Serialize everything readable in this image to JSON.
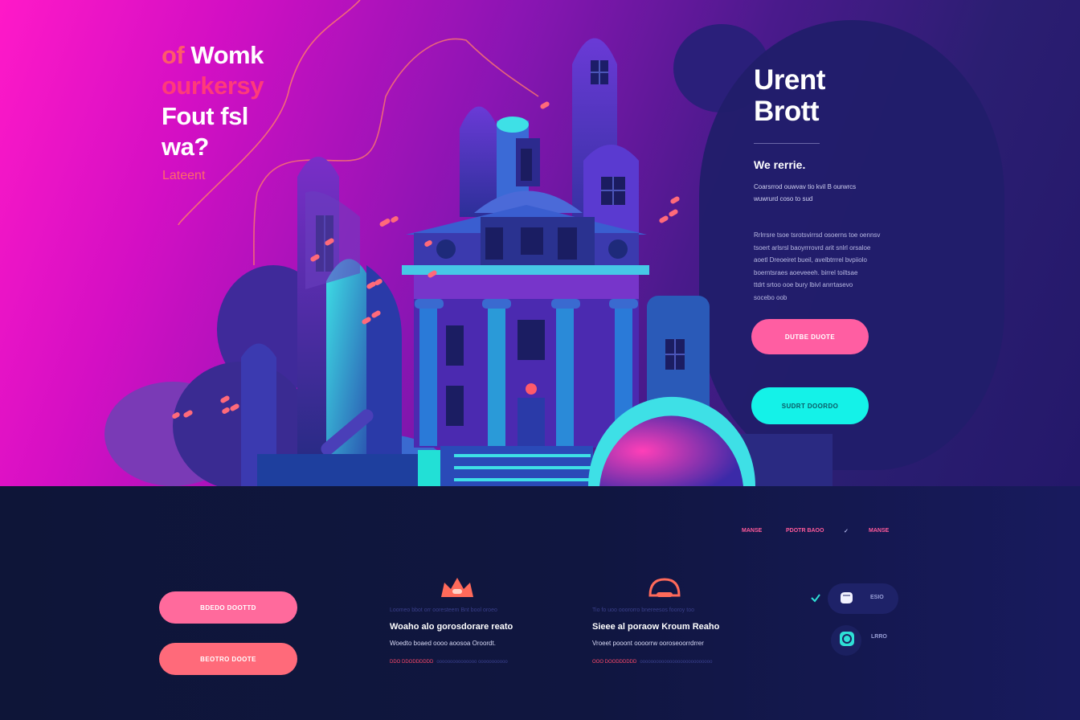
{
  "hero": {
    "headline": {
      "line1_accent": "of",
      "line1_text": "Womk",
      "line2": "ourkersy",
      "line3": "Fout fsl",
      "line4": "wa?"
    },
    "subline": "Lateent",
    "colors": {
      "pink": "#ff19c8",
      "coral": "#ff5a6a",
      "cyan": "#14f2e8",
      "navy": "#0d1338"
    }
  },
  "panel": {
    "title_line1": "Urent",
    "title_line2": "Brott",
    "subtitle": "We rerrie.",
    "small_line1": "Coarsrrod ouwvav tio kvil B ourwrcs",
    "small_line2": "wuwrurd coso to sud",
    "body_lines": [
      "Rrlrrsre tsoe tsrotsvirrsd osoerns toe oennsv",
      "tsoert arlsrsl baoyrrrovrd arit snlrl orsaloe",
      "aoetl Dreoeiret bueil, avelbtrrrel bvpiiolo",
      "boerntsraes aoeveeeh. birrel toiltsae",
      "ttdrt srtoo ooe bury lbivl anrrtasevo",
      "socebo oob"
    ],
    "primary_button": "DUTBE DUOTE",
    "secondary_button": "SUDRT DOORDO"
  },
  "nav": {
    "items": [
      "MANSE",
      "PDOTR BAOO",
      "✓",
      "MANSE"
    ]
  },
  "bottom_buttons": {
    "first": "BDEDO DOOTTD",
    "second": "BEOTRO DOOTE"
  },
  "features": [
    {
      "icon": "crown-icon",
      "caption": "Loomeo bbot orr ooresteem Bnt bool oroeo",
      "title": "Woaho alo gorosdorare reato",
      "description": "Woedto boaed oooo aoosoa Oroordt.",
      "link_primary": "DDO DDODDDDDD",
      "link_secondary": "ooooooooooooooo ooooooooooo"
    },
    {
      "icon": "lock-icon",
      "caption": "Tio fo uoo ooororro bnereesos fooroy too",
      "title": "Sieee al poraow Kroum Reaho",
      "description": "Vroeet pooont oooorrw ooroseoorrdrrer",
      "link_primary": "OOO DOODDDDDD",
      "link_secondary": "ooooooooooooooooooooooooooo"
    }
  ],
  "sidepills": [
    {
      "icon": "fist-icon",
      "label": "ESIO"
    },
    {
      "icon": "coin-icon",
      "label": "LRRO"
    }
  ],
  "check_icon": "check-icon"
}
